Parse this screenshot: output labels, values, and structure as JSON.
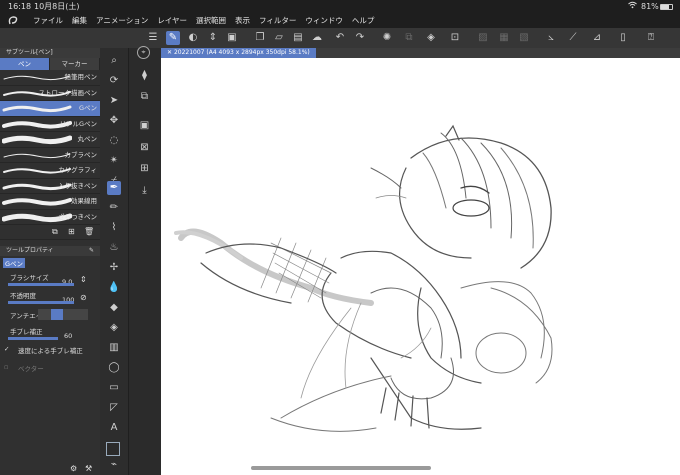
{
  "status_bar": {
    "time": "16:18",
    "date": "10月8日(土)",
    "battery": "81%"
  },
  "menu": [
    "ファイル",
    "編集",
    "アニメーション",
    "レイヤー",
    "選択範囲",
    "表示",
    "フィルター",
    "ウィンドウ",
    "ヘルプ"
  ],
  "document": {
    "tab_title": "20221007 (A4 4093 x 2894px 350dpi 58.1%)"
  },
  "subtool_panel": {
    "header": "サブツール[ペン]",
    "tabs": [
      {
        "label": "ペン",
        "selected": true
      },
      {
        "label": "マーカー",
        "selected": false
      }
    ],
    "brushes": [
      {
        "label": "鉛筆用ペン",
        "selected": false
      },
      {
        "label": "ストローク描画ペン",
        "selected": false
      },
      {
        "label": "Gペン",
        "selected": true
      },
      {
        "label": "リアルGペン",
        "selected": false
      },
      {
        "label": "丸ペン",
        "selected": false
      },
      {
        "label": "カブラペン",
        "selected": false
      },
      {
        "label": "カリグラフィ",
        "selected": false
      },
      {
        "label": "入り抜きペン",
        "selected": false
      },
      {
        "label": "効果線用",
        "selected": false
      },
      {
        "label": "ざらつきペン",
        "selected": false
      }
    ]
  },
  "tool_property": {
    "header": "ツールプロパティ",
    "tool_name": "Gペン",
    "brush_size_label": "ブラシサイズ",
    "brush_size_value": "9.0",
    "opacity_label": "不透明度",
    "opacity_value": "100",
    "antialias_label": "アンチエイリ",
    "stabilization_label": "手ブレ補正",
    "stabilization_value": "60",
    "speed_stabilization_label": "速度による手ブレ補正",
    "vector_label": "ベクター"
  },
  "colors": {
    "accent": "#5a7bc4",
    "panel": "#303030",
    "canvas": "#ffffff"
  }
}
